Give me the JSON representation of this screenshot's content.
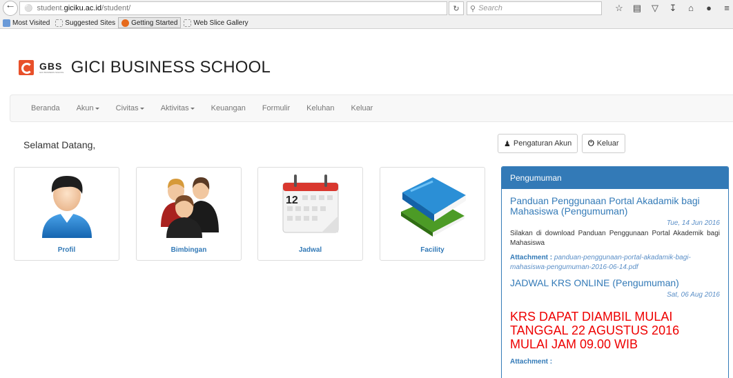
{
  "browser": {
    "url_prefix": "student.",
    "url_domain": "giciku.ac.id",
    "url_path": "/student/",
    "search_placeholder": "Search",
    "bookmarks": [
      "Most Visited",
      "Suggested Sites",
      "Getting Started",
      "Web Slice Gallery"
    ]
  },
  "header": {
    "logo_text": "GBS",
    "logo_sub": "GICI BUSINESS SCHOOL",
    "title": "GICI BUSINESS SCHOOL"
  },
  "nav": {
    "items": [
      "Beranda",
      "Akun",
      "Civitas",
      "Aktivitas",
      "Keuangan",
      "Formulir",
      "Keluhan",
      "Keluar"
    ]
  },
  "welcome": "Selamat Datang,",
  "tiles": [
    "Profil",
    "Bimbingan",
    "Jadwal",
    "Facility"
  ],
  "calendar_day": "12",
  "account": {
    "settings_label": "Pengaturan Akun",
    "logout_label": "Keluar"
  },
  "announcements": {
    "heading": "Pengumuman",
    "items": [
      {
        "title": "Panduan Penggunaan Portal Akadamik bagi Mahasiswa (Pengumuman)",
        "date": "Tue, 14 Jun 2016",
        "desc": "Silakan di download Panduan Penggunaan Portal Akademik bagi Mahasiswa",
        "attach_label": "Attachment :",
        "attach_file": "panduan-penggunaan-portal-akadamik-bagi-mahasiswa-pengumuman-2016-06-14.pdf"
      },
      {
        "title": "JADWAL KRS ONLINE (Pengumuman)",
        "date": "Sat, 06 Aug 2016",
        "big": "KRS DAPAT DIAMBIL MULAI TANGGAL 22 AGUSTUS 2016 MULAI JAM 09.00 WIB",
        "attach_label": "Attachment :"
      }
    ]
  }
}
